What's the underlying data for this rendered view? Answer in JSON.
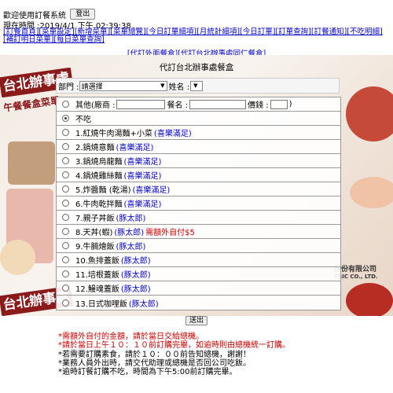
{
  "header": {
    "welcome": "歡迎使用訂餐系統",
    "logout_label": "登出",
    "now_time": "現在時間 :2019/4/1 下午 02:39:38"
  },
  "menu": {
    "items": [
      "[訂餐首頁]",
      "[菜單設定]",
      "[新增菜單]",
      "[菜單總覽]",
      "[今日訂單細項]",
      "[月統計細項]",
      "[今日訂單]",
      "[訂單查詢]",
      "[訂餐通知]",
      "[不吃明細]",
      "[補訂明日菜單]",
      "[每日菜單查詢]"
    ]
  },
  "submenu": {
    "items": [
      "[代訂外面餐盒]",
      "[代訂台北辦事處同仁餐盒]"
    ]
  },
  "banner": {
    "shop_name": "台北辦事處",
    "shop_sub": "午餐餐盒菜單",
    "company_cn": "股份有限公司",
    "company_latin": "TRIC CO., LTD."
  },
  "page_title": "代訂台北辦事處餐盒",
  "filter": {
    "department_label": "部門 :",
    "department_value": "請選擇",
    "name_label": "姓名 :",
    "name_value": ""
  },
  "other_row": {
    "label": "其他(廠商 :",
    "meal_label": "餐名 :",
    "price_label": "價錢 :",
    "close_paren": ")"
  },
  "options": [
    {
      "text": "不吃",
      "shop": "",
      "extra": "",
      "selected": true
    },
    {
      "text": "1.紅燒牛肉湯麵+小菜",
      "shop": "(喜樂滿足)",
      "extra": "",
      "selected": false
    },
    {
      "text": "2.鍋燒意麵",
      "shop": "(喜樂滿足)",
      "extra": "",
      "selected": false
    },
    {
      "text": "3.鍋燒烏龍麵",
      "shop": "(喜樂滿足)",
      "extra": "",
      "selected": false
    },
    {
      "text": "4.鍋燒雞絲麵",
      "shop": "(喜樂滿足)",
      "extra": "",
      "selected": false
    },
    {
      "text": "5.炸醬麵 (乾湯)",
      "shop": "(喜樂滿足)",
      "extra": "",
      "selected": false
    },
    {
      "text": "6.牛肉乾拌麵",
      "shop": "(喜樂滿足)",
      "extra": "",
      "selected": false
    },
    {
      "text": "7.親子丼飯",
      "shop": "(豚太郎)",
      "extra": "",
      "selected": false
    },
    {
      "text": "8.天丼(蝦)",
      "shop": "(豚太郎)",
      "extra": "需額外自付$5",
      "selected": false
    },
    {
      "text": "9.牛腩燴飯",
      "shop": "(豚太郎)",
      "extra": "",
      "selected": false
    },
    {
      "text": "10.魚排蓋飯",
      "shop": "(豚太郎)",
      "extra": "",
      "selected": false
    },
    {
      "text": "11.培根蓋飯",
      "shop": "(豚太郎)",
      "extra": "",
      "selected": false
    },
    {
      "text": "12.鰻魂蓋飯",
      "shop": "(豚太郎)",
      "extra": "",
      "selected": false
    },
    {
      "text": "13.日式咖哩飯",
      "shop": "(豚太郎)",
      "extra": "",
      "selected": false
    }
  ],
  "submit_label": "送出",
  "notes": [
    "*需額外自付的金額，請於當日交給總機。",
    "*請於當日上午１０：１０前訂購完畢，如逾時則由總機統一訂購。",
    "*若需要訂購素食，請於１０：００前告知總機，謝謝！",
    "*業務人員外出時，請交代助理或總機是否回公司吃飯。",
    "*逾時訂餐訂購不吃，時間為下午5:00前訂購完畢。"
  ],
  "colors": {
    "link": "#0000cc",
    "alert": "#cc0000",
    "brand": "#8b1a1a"
  }
}
